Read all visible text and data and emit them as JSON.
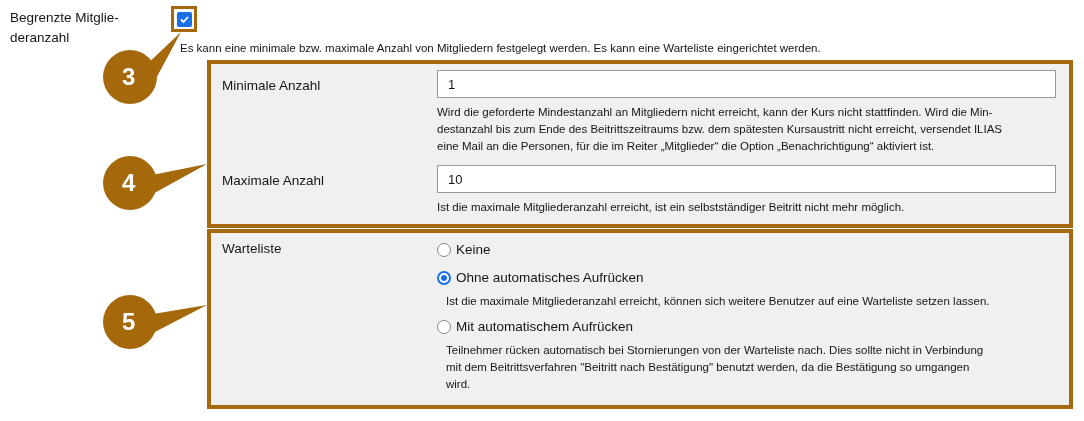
{
  "limit": {
    "label": "Begrenzte Mitglie-\nderanzahl",
    "checked": true,
    "description": "Es kann eine minimale bzw. maximale Anzahl von Mitgliedern festgelegt werden. Es kann eine Warteliste eingerichtet werden."
  },
  "count_fields": [
    {
      "label": "Minimale Anzahl",
      "value": "1",
      "description": "Wird die geforderte Mindestanzahl an Mitgliedern nicht erreicht, kann der Kurs nicht stattfinden. Wird die Min-\ndestanzahl bis zum Ende des Beitrittszeitraums bzw. dem spätesten Kursaustritt nicht erreicht, versendet ILIAS\neine Mail an die Personen, für die im Reiter „Mitglieder“ die Option „Benachrichtigung“ aktiviert ist."
    },
    {
      "label": "Maximale Anzahl",
      "value": "10",
      "description": "Ist die maximale Mitgliederanzahl erreicht, ist ein selbstständiger Beitritt nicht mehr möglich."
    }
  ],
  "waitlist": {
    "label": "Warteliste",
    "options": [
      {
        "label": "Keine",
        "selected": false
      },
      {
        "label": "Ohne automatisches Aufrücken",
        "selected": true,
        "description": "Ist die maximale Mitgliederanzahl erreicht, können sich weitere Benutzer auf eine Warteliste setzen lassen."
      },
      {
        "label": "Mit automatischem Aufrücken",
        "selected": false,
        "description": "Teilnehmer rücken automatisch bei Stornierungen von der Warteliste nach. Dies sollte nicht in Verbindung\nmit dem Beitrittsverfahren \"Beitritt nach Bestätigung\" benutzt werden, da die Bestätigung so umgangen\nwird."
      }
    ]
  },
  "callouts": [
    {
      "number": "3"
    },
    {
      "number": "4"
    },
    {
      "number": "5"
    }
  ]
}
